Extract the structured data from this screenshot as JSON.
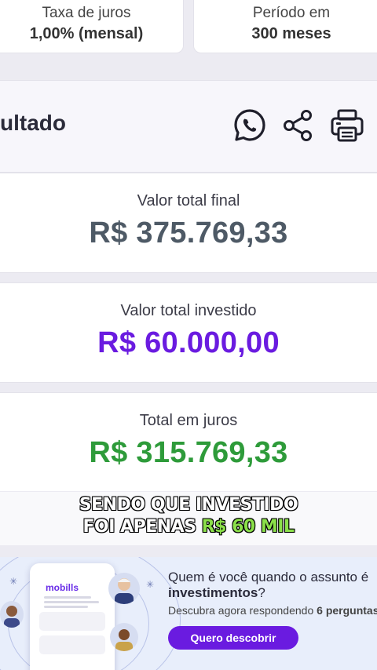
{
  "summary": {
    "rate_label": "Taxa de juros",
    "rate_value": "1,00% (mensal)",
    "period_label": "Período em",
    "period_value": "300 meses"
  },
  "result": {
    "title": "ultado",
    "icons": [
      "whatsapp-icon",
      "share-icon",
      "printer-icon"
    ]
  },
  "values": {
    "final_label": "Valor total final",
    "final_value": "R$ 375.769,33",
    "invested_label": "Valor total investido",
    "invested_value": "R$ 60.000,00",
    "interest_label": "Total em juros",
    "interest_value": "R$ 315.769,33"
  },
  "colors": {
    "final": "#4e5a66",
    "invested": "#6a1be0",
    "interest": "#2e9b3a",
    "accent": "#6a1be0"
  },
  "caption": {
    "line1": "SENDO QUE INVESTIDO",
    "line2_prefix": "FOI APENAS ",
    "line2_highlight": "R$ 60 MIL"
  },
  "ad": {
    "brand": "mobills",
    "title_prefix": "Quem é você quando o assunto é ",
    "title_bold": "investimentos",
    "title_suffix": "?",
    "sub_prefix": "Descubra agora respondendo ",
    "sub_bold": "6 perguntas",
    "button_label": "Quero descobrir"
  }
}
